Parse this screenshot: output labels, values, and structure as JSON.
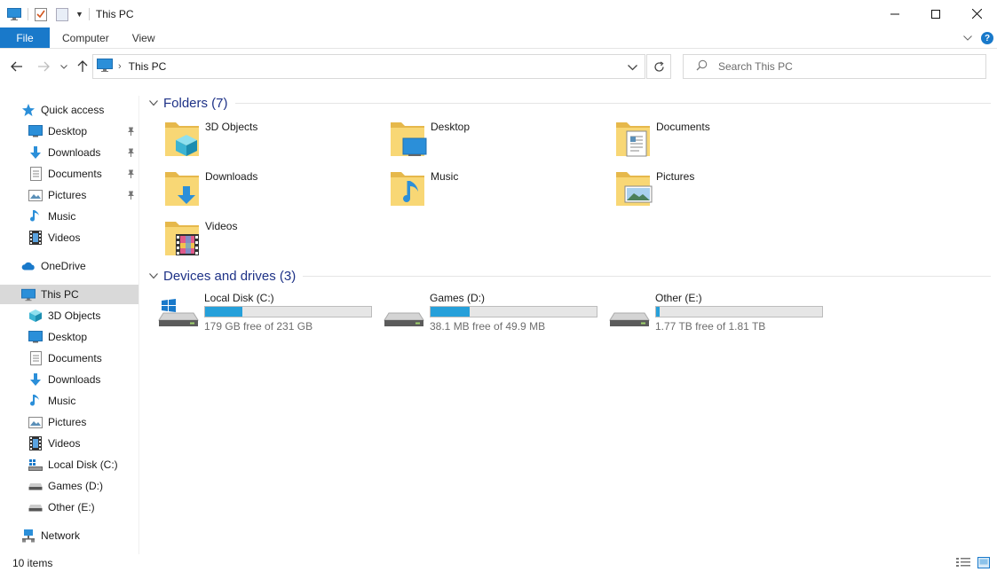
{
  "window": {
    "title": "This PC"
  },
  "ribbon": {
    "file_tab": "File",
    "tabs": [
      "Computer",
      "View"
    ]
  },
  "address": {
    "path": "This PC",
    "search_placeholder": "Search This PC"
  },
  "sidebar": {
    "items": [
      {
        "label": "Quick access",
        "icon": "star-icon",
        "pinned": false
      },
      {
        "label": "Desktop",
        "icon": "desktop-icon",
        "pinned": true
      },
      {
        "label": "Downloads",
        "icon": "downloads-icon",
        "pinned": true
      },
      {
        "label": "Documents",
        "icon": "documents-icon",
        "pinned": true
      },
      {
        "label": "Pictures",
        "icon": "pictures-icon",
        "pinned": true
      },
      {
        "label": "Music",
        "icon": "music-icon",
        "pinned": false
      },
      {
        "label": "Videos",
        "icon": "videos-icon",
        "pinned": false
      },
      {
        "label": "OneDrive",
        "icon": "cloud-icon",
        "pinned": false
      },
      {
        "label": "This PC",
        "icon": "computer-icon",
        "pinned": false,
        "selected": true
      },
      {
        "label": "3D Objects",
        "icon": "cube-icon",
        "pinned": false
      },
      {
        "label": "Desktop",
        "icon": "desktop-icon",
        "pinned": false
      },
      {
        "label": "Documents",
        "icon": "documents-icon",
        "pinned": false
      },
      {
        "label": "Downloads",
        "icon": "downloads-icon",
        "pinned": false
      },
      {
        "label": "Music",
        "icon": "music-icon",
        "pinned": false
      },
      {
        "label": "Pictures",
        "icon": "pictures-icon",
        "pinned": false
      },
      {
        "label": "Videos",
        "icon": "videos-icon",
        "pinned": false
      },
      {
        "label": "Local Disk (C:)",
        "icon": "windows-drive-icon",
        "pinned": false
      },
      {
        "label": "Games (D:)",
        "icon": "drive-icon",
        "pinned": false
      },
      {
        "label": "Other (E:)",
        "icon": "drive-icon",
        "pinned": false
      },
      {
        "label": "Network",
        "icon": "network-icon",
        "pinned": false
      }
    ]
  },
  "folders": {
    "header": "Folders (7)",
    "items": [
      {
        "label": "3D Objects",
        "icon": "folder-3d-objects-icon"
      },
      {
        "label": "Desktop",
        "icon": "folder-desktop-icon"
      },
      {
        "label": "Documents",
        "icon": "folder-documents-icon"
      },
      {
        "label": "Downloads",
        "icon": "folder-downloads-icon"
      },
      {
        "label": "Music",
        "icon": "folder-music-icon"
      },
      {
        "label": "Pictures",
        "icon": "folder-pictures-icon"
      },
      {
        "label": "Videos",
        "icon": "folder-videos-icon"
      }
    ]
  },
  "drives": {
    "header": "Devices and drives (3)",
    "items": [
      {
        "label": "Local Disk (C:)",
        "free": "179 GB free of 231 GB",
        "used_fraction": 0.225,
        "icon": "windows-drive-icon"
      },
      {
        "label": "Games (D:)",
        "free": "38.1 MB free of 49.9 MB",
        "used_fraction": 0.236,
        "icon": "drive-icon"
      },
      {
        "label": "Other (E:)",
        "free": "1.77 TB free of 1.81 TB",
        "used_fraction": 0.022,
        "icon": "drive-icon"
      }
    ]
  },
  "status": {
    "item_count": "10 items"
  },
  "colors": {
    "accent": "#1979ca",
    "header_text": "#1e3287",
    "drive_bar": "#26a0da",
    "folder_yellow": "#f8d775",
    "selected_bg": "#d9d9d9"
  }
}
